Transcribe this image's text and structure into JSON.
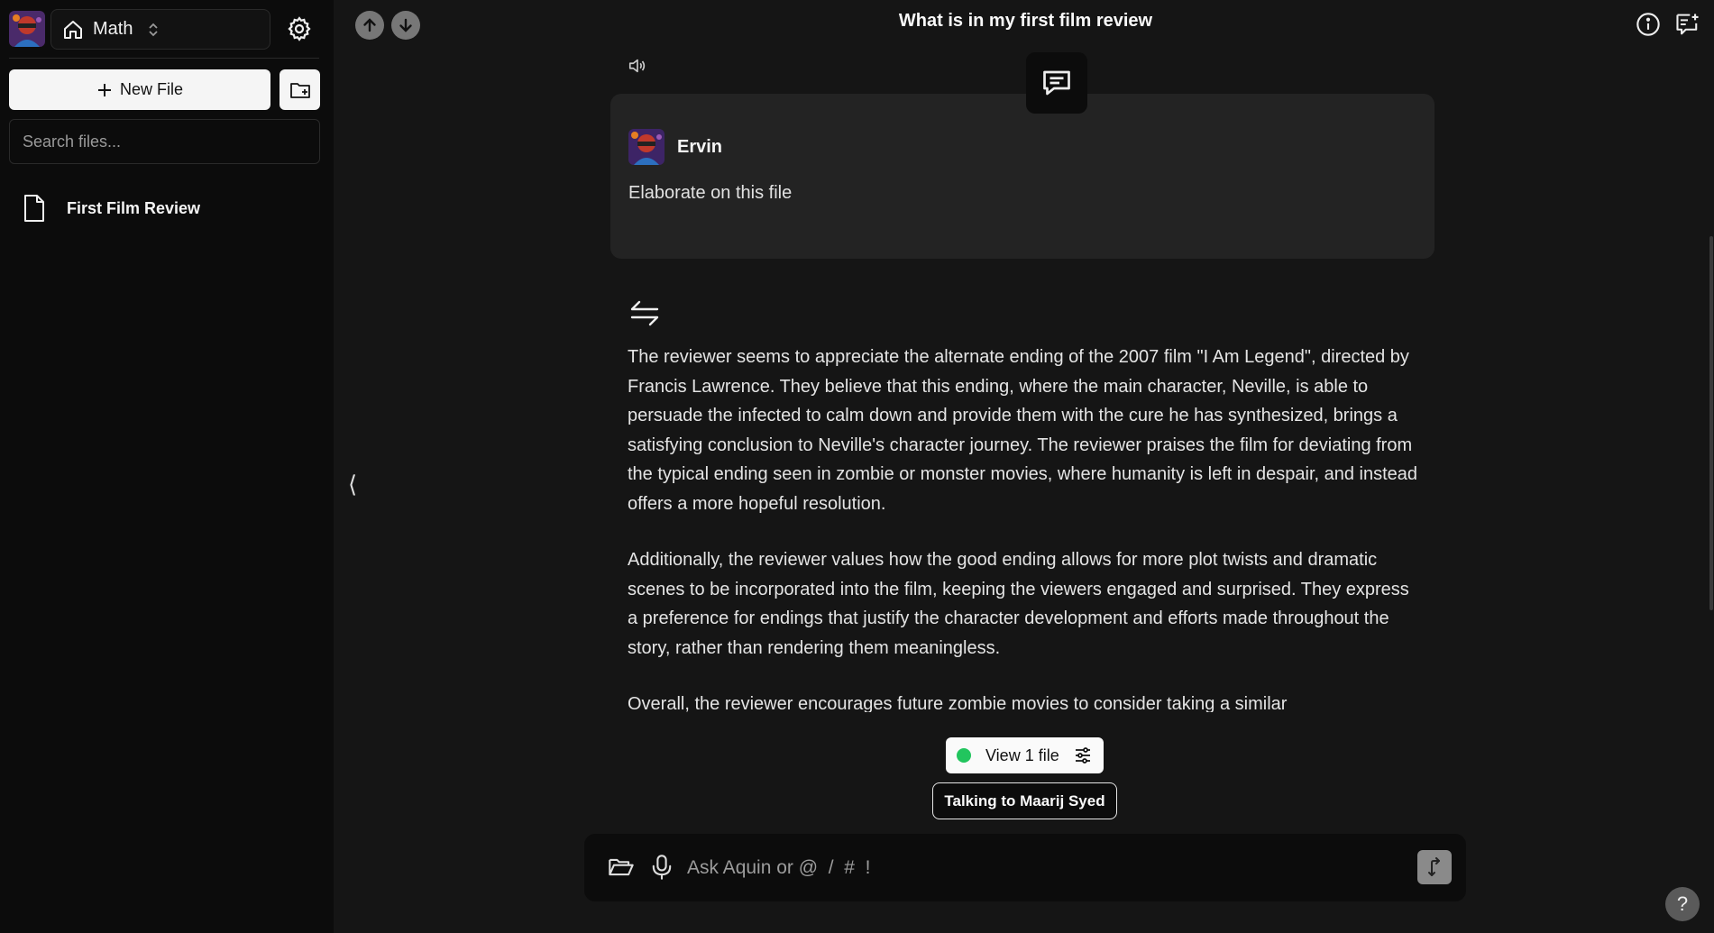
{
  "sidebar": {
    "workspace": "Math",
    "new_file_label": "New File",
    "search_placeholder": "Search files...",
    "files": [
      {
        "name": "First Film Review"
      }
    ]
  },
  "header": {
    "title": "What is in my first film review"
  },
  "collapse_glyph": "⟨",
  "conversation": {
    "user": {
      "name": "Ervin",
      "message": "Elaborate on this file"
    },
    "response_paragraphs": [
      "The reviewer seems to appreciate the alternate ending of the 2007 film \"I Am Legend\", directed by Francis Lawrence. They believe that this ending, where the main character, Neville, is able to persuade the infected to calm down and provide them with the cure he has synthesized, brings a satisfying conclusion to Neville's character journey. The reviewer praises the film for deviating from the typical ending seen in zombie or monster movies, where humanity is left in despair, and instead offers a more hopeful resolution.",
      "Additionally, the reviewer values how the good ending allows for more plot twists and dramatic scenes to be incorporated into the film, keeping the viewers engaged and surprised. They express a preference for endings that justify the character development and efforts made throughout the story, rather than rendering them meaningless.",
      "Overall, the reviewer encourages future zombie movies to consider taking a similar"
    ]
  },
  "context": {
    "view_files_label": "View 1 file",
    "talking_to_label": "Talking to Maarij Syed"
  },
  "composer": {
    "placeholder": "Ask Aquin or @  /  #  !"
  },
  "help_label": "?",
  "colors": {
    "background": "#151515",
    "sidebar": "#0c0c0c",
    "card": "#232323",
    "status_dot": "#22c55e"
  }
}
